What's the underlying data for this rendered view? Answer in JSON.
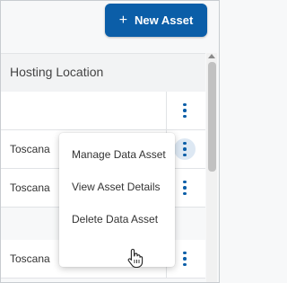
{
  "toolbar": {
    "new_asset_label": "New Asset",
    "new_asset_icon": "plus-icon",
    "accent_color": "#0b5ea8"
  },
  "table": {
    "column_header": "Hosting Location",
    "rows": [
      {
        "location": ""
      },
      {
        "location": "Toscana"
      },
      {
        "location": "Toscana"
      },
      {
        "location": "Toscana"
      }
    ],
    "row_action_icon": "more-vertical-icon"
  },
  "context_menu": {
    "items": [
      {
        "label": "Manage Data Asset"
      },
      {
        "label": "View Asset Details"
      },
      {
        "label": "Delete Data Asset"
      }
    ]
  }
}
